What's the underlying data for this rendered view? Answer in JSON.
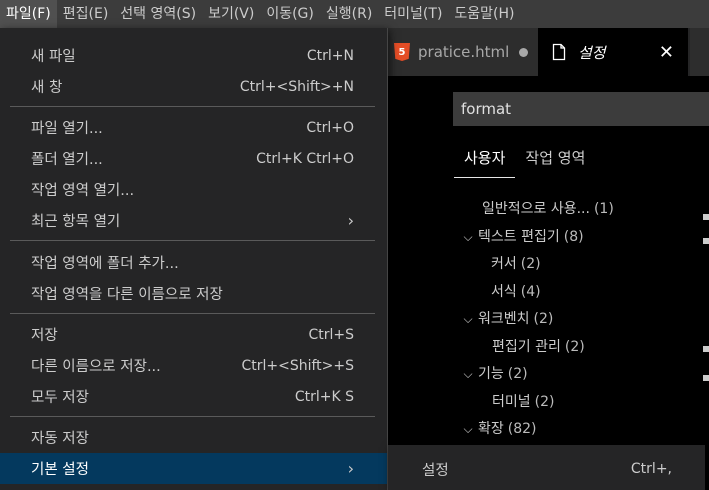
{
  "menubar": {
    "items": [
      {
        "label": "파일(F)"
      },
      {
        "label": "편집(E)"
      },
      {
        "label": "선택 영역(S)"
      },
      {
        "label": "보기(V)"
      },
      {
        "label": "이동(G)"
      },
      {
        "label": "실행(R)"
      },
      {
        "label": "터미널(T)"
      },
      {
        "label": "도움말(H)"
      }
    ]
  },
  "file_menu": {
    "items": [
      {
        "label": "새 파일",
        "shortcut": "Ctrl+N"
      },
      {
        "label": "새 창",
        "shortcut": "Ctrl+<Shift>+N"
      },
      {
        "label": "파일 열기...",
        "shortcut": "Ctrl+O"
      },
      {
        "label": "폴더 열기...",
        "shortcut": "Ctrl+K Ctrl+O"
      },
      {
        "label": "작업 영역 열기...",
        "shortcut": ""
      },
      {
        "label": "최근 항목 열기",
        "shortcut": ""
      },
      {
        "label": "작업 영역에 폴더 추가...",
        "shortcut": ""
      },
      {
        "label": "작업 영역을 다른 이름으로 저장",
        "shortcut": ""
      },
      {
        "label": "저장",
        "shortcut": "Ctrl+S"
      },
      {
        "label": "다른 이름으로 저장...",
        "shortcut": "Ctrl+<Shift>+S"
      },
      {
        "label": "모두 저장",
        "shortcut": "Ctrl+K S"
      },
      {
        "label": "자동 저장",
        "shortcut": ""
      },
      {
        "label": "기본 설정",
        "shortcut": ""
      }
    ]
  },
  "submenu": {
    "label": "설정",
    "shortcut": "Ctrl+,"
  },
  "tabs": {
    "inactive_label": "pratice.html",
    "active_label": "설정",
    "html_badge": "5"
  },
  "settings": {
    "search_value": "format",
    "scope_tabs": [
      "사용자",
      "작업 영역"
    ],
    "toc": [
      {
        "label": "일반적으로 사용...",
        "count": "(1)",
        "expanded": null
      },
      {
        "label": "텍스트 편집기",
        "count": "(8)",
        "expanded": true
      },
      {
        "label": "커서",
        "count": "(2)",
        "expanded": null
      },
      {
        "label": "서식",
        "count": "(4)",
        "expanded": null
      },
      {
        "label": "워크벤치",
        "count": "(2)",
        "expanded": true
      },
      {
        "label": "편집기 관리",
        "count": "(2)",
        "expanded": null
      },
      {
        "label": "기능",
        "count": "(2)",
        "expanded": true
      },
      {
        "label": "터미널",
        "count": "(2)",
        "expanded": null
      },
      {
        "label": "확장",
        "count": "(82)",
        "expanded": true
      }
    ]
  },
  "colors": {
    "menubar_bg": "#3c3c3c",
    "menu_bg": "#252526",
    "selected_bg": "#04395e",
    "editor_bg": "#000000"
  }
}
